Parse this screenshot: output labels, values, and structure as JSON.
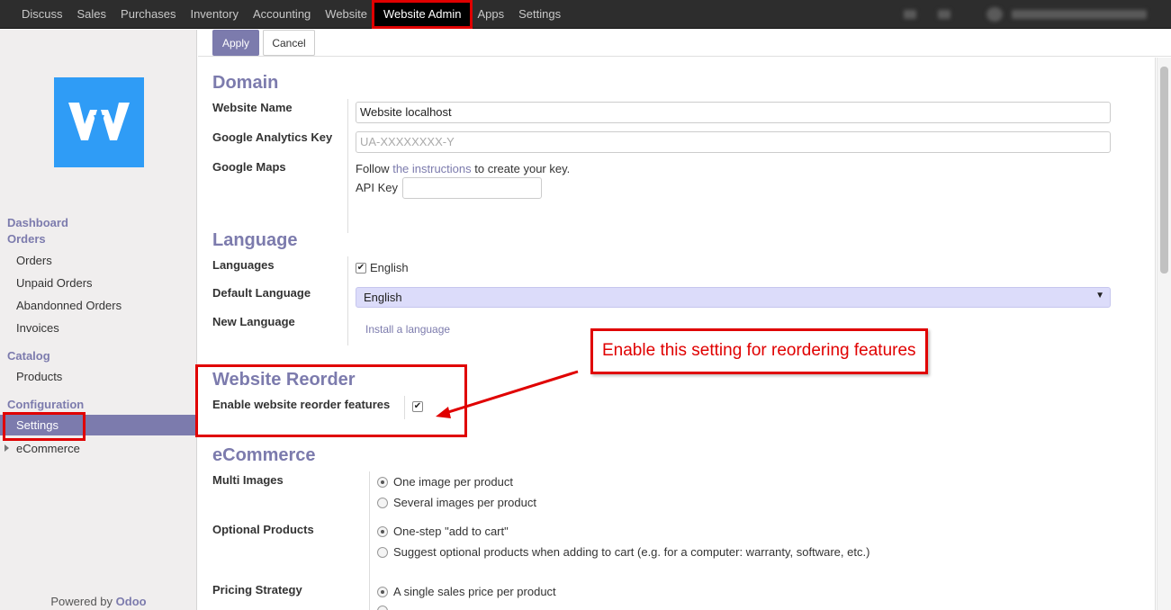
{
  "topbar": {
    "menu": [
      "Discuss",
      "Sales",
      "Purchases",
      "Inventory",
      "Accounting",
      "Website",
      "Website Admin",
      "Apps",
      "Settings"
    ],
    "active_menu": "Website Admin"
  },
  "sidebar": {
    "logo_icon": "website-w-logo-icon",
    "logo_color": "#2f9cf6",
    "dashboard": "Dashboard",
    "orders_header": "Orders",
    "orders_items": [
      "Orders",
      "Unpaid Orders",
      "Abandonned Orders",
      "Invoices"
    ],
    "catalog_header": "Catalog",
    "catalog_items": [
      "Products"
    ],
    "config_header": "Configuration",
    "config_items": [
      "Settings",
      "eCommerce"
    ],
    "active_item": "Settings",
    "powered_prefix": "Powered by",
    "powered_brand": "Odoo"
  },
  "toolbar": {
    "apply_label": "Apply",
    "cancel_label": "Cancel"
  },
  "domain": {
    "title": "Domain",
    "website_name_label": "Website Name",
    "website_name_value": "Website localhost",
    "ga_label": "Google Analytics Key",
    "ga_placeholder": "UA-XXXXXXXX-Y",
    "maps_label": "Google Maps",
    "maps_text_before": "Follow",
    "maps_link": "the instructions",
    "maps_text_after": "to create your key.",
    "api_key_label": "API Key",
    "api_key_value": ""
  },
  "language": {
    "title": "Language",
    "languages_label": "Languages",
    "languages_checked": "English",
    "default_label": "Default Language",
    "default_value": "English",
    "new_label": "New Language",
    "install_link": "Install a language"
  },
  "reorder": {
    "title": "Website Reorder",
    "enable_label": "Enable website reorder features",
    "enabled": true
  },
  "annotation": {
    "callout_text": "Enable this setting for reordering features",
    "color": "#e00000"
  },
  "ecommerce": {
    "title": "eCommerce",
    "multi_images_label": "Multi Images",
    "multi_images_options": [
      "One image per product",
      "Several images per product"
    ],
    "multi_images_selected": 0,
    "optional_label": "Optional Products",
    "optional_options": [
      "One-step \"add to cart\"",
      "Suggest optional products when adding to cart (e.g. for a computer: warranty, software, etc.)"
    ],
    "optional_selected": 0,
    "pricing_label": "Pricing Strategy",
    "pricing_options": [
      "A single sales price per product"
    ],
    "pricing_selected": 0
  },
  "colors": {
    "accent": "#7c7bad",
    "navbar": "#2d2d2d",
    "highlight": "#e00000"
  }
}
